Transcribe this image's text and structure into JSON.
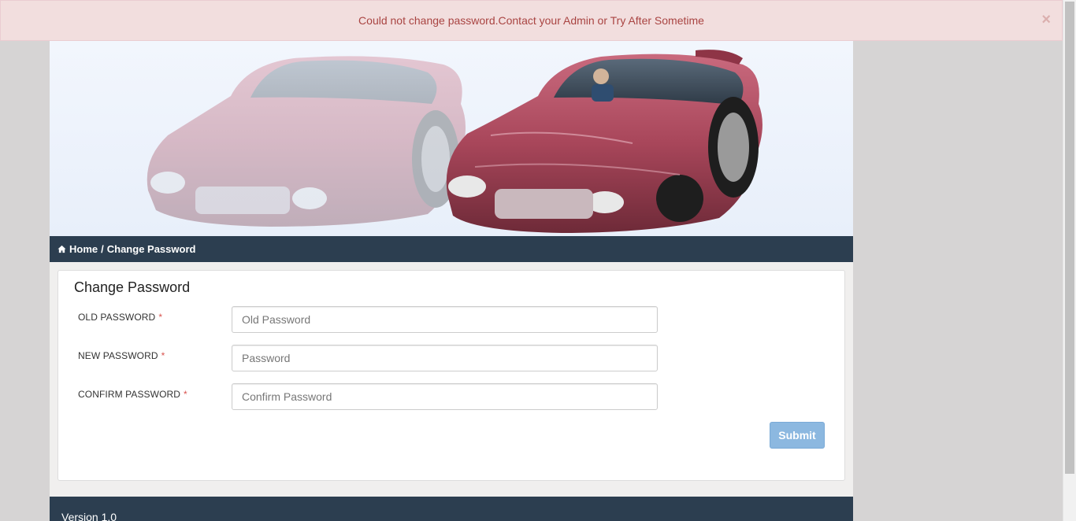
{
  "alert": {
    "message": "Could not change password.Contact your Admin or Try After Sometime",
    "close_label": "×"
  },
  "banner": {
    "image": "red-sports-car-wireframe-banner"
  },
  "breadcrumb": {
    "home_label": "Home",
    "separator": "/",
    "current_label": "Change Password"
  },
  "form": {
    "title": "Change Password",
    "required_mark": "*",
    "fields": [
      {
        "label": "OLD PASSWORD",
        "placeholder": "Old Password",
        "value": ""
      },
      {
        "label": "NEW PASSWORD",
        "placeholder": "Password",
        "value": ""
      },
      {
        "label": "CONFIRM PASSWORD",
        "placeholder": "Confirm Password",
        "value": ""
      }
    ],
    "submit_label": "Submit"
  },
  "footer": {
    "version": "Version 1.0"
  },
  "colors": {
    "nav_bg": "#2c3e50",
    "alert_bg": "#f2dede",
    "alert_text": "#a94442",
    "submit_bg": "#8cb8e0",
    "required": "#d9534f"
  }
}
